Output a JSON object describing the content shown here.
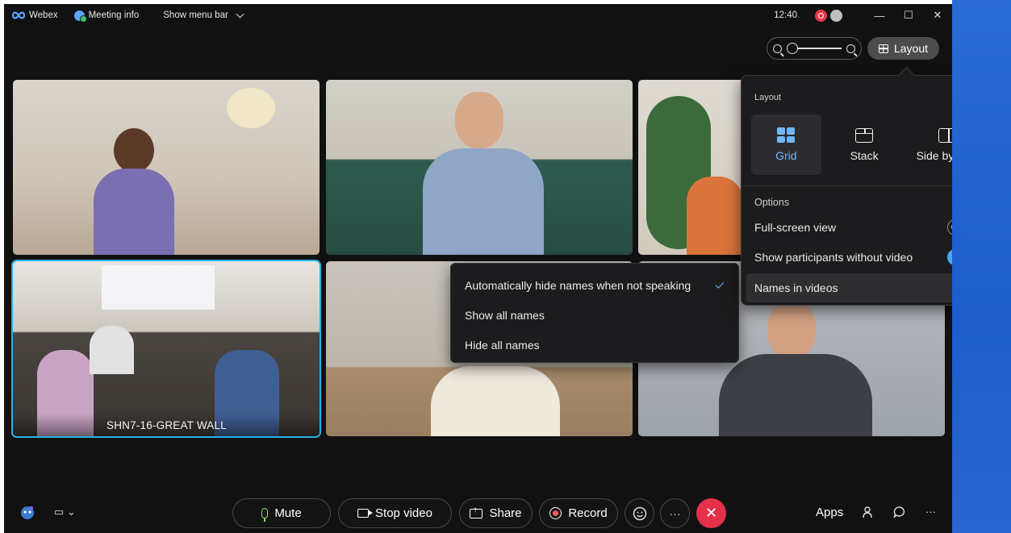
{
  "title_bar": {
    "app_name": "Webex",
    "meeting_info": "Meeting info",
    "show_menu_bar": "Show menu bar",
    "clock": "12:40"
  },
  "toolbar": {
    "layout_label": "Layout"
  },
  "tiles": [
    {
      "name": ""
    },
    {
      "name": ""
    },
    {
      "name": ""
    },
    {
      "name": "SHN7-16-GREAT WALL"
    },
    {
      "name": ""
    },
    {
      "name": ""
    }
  ],
  "layout_panel": {
    "header": "Layout",
    "options": [
      {
        "label": "Grid",
        "selected": true
      },
      {
        "label": "Stack",
        "selected": false
      },
      {
        "label": "Side by side",
        "selected": false
      }
    ],
    "options_header": "Options",
    "full_screen_label": "Full-screen view",
    "full_screen_on": false,
    "show_without_video_label": "Show participants without video",
    "show_without_video_on": true,
    "names_in_videos_label": "Names in videos"
  },
  "names_menu": {
    "items": [
      {
        "label": "Automatically hide names when not speaking",
        "checked": true
      },
      {
        "label": "Show all names",
        "checked": false
      },
      {
        "label": "Hide all names",
        "checked": false
      }
    ]
  },
  "bottom_bar": {
    "mute": "Mute",
    "stop_video": "Stop video",
    "share": "Share",
    "record": "Record",
    "more": "···",
    "apps": "Apps"
  },
  "colors": {
    "accent": "#4aa6ff",
    "leave": "#e5304a",
    "active_speaker_border": "#26b3e3",
    "window_bg": "#111112"
  }
}
